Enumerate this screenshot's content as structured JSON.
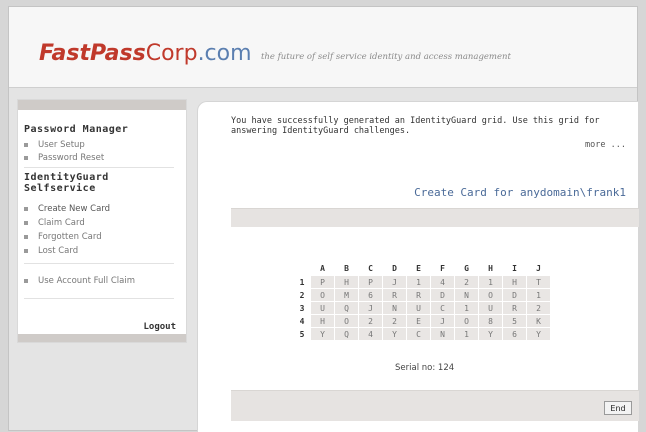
{
  "header": {
    "logo_fast": "FastPass",
    "logo_corp": "Corp",
    "logo_com": ".com",
    "tagline": "the future of self service identity and access management"
  },
  "sidebar": {
    "section1_title": "Password Manager",
    "section1_items": [
      "User Setup",
      "Password Reset"
    ],
    "section2_title_line1": "IdentityGuard",
    "section2_title_line2": "Selfservice",
    "section2_items": [
      "Create New Card",
      "Claim Card",
      "Forgotten Card",
      "Lost Card"
    ],
    "section3_items": [
      "Use Account Full Claim"
    ],
    "logout": "Logout"
  },
  "main": {
    "message": "You have successfully generated an IdentityGuard grid. Use this grid for answering IdentityGuard challenges.",
    "more": "more ...",
    "create_card_title": "Create Card for  anydomain\\frank1",
    "serial_label": "Serial no:",
    "serial_value": "124",
    "end_button": "End"
  },
  "grid": {
    "columns": [
      "A",
      "B",
      "C",
      "D",
      "E",
      "F",
      "G",
      "H",
      "I",
      "J"
    ],
    "rows": [
      {
        "label": "1",
        "cells": [
          "P",
          "H",
          "P",
          "J",
          "1",
          "4",
          "2",
          "1",
          "H",
          "T"
        ]
      },
      {
        "label": "2",
        "cells": [
          "O",
          "M",
          "6",
          "R",
          "R",
          "D",
          "N",
          "O",
          "D",
          "1"
        ]
      },
      {
        "label": "3",
        "cells": [
          "U",
          "Q",
          "J",
          "N",
          "U",
          "C",
          "1",
          "U",
          "R",
          "2"
        ]
      },
      {
        "label": "4",
        "cells": [
          "H",
          "O",
          "2",
          "2",
          "E",
          "J",
          "O",
          "8",
          "5",
          "K"
        ]
      },
      {
        "label": "5",
        "cells": [
          "Y",
          "Q",
          "4",
          "Y",
          "C",
          "N",
          "1",
          "Y",
          "6",
          "Y"
        ]
      }
    ]
  }
}
